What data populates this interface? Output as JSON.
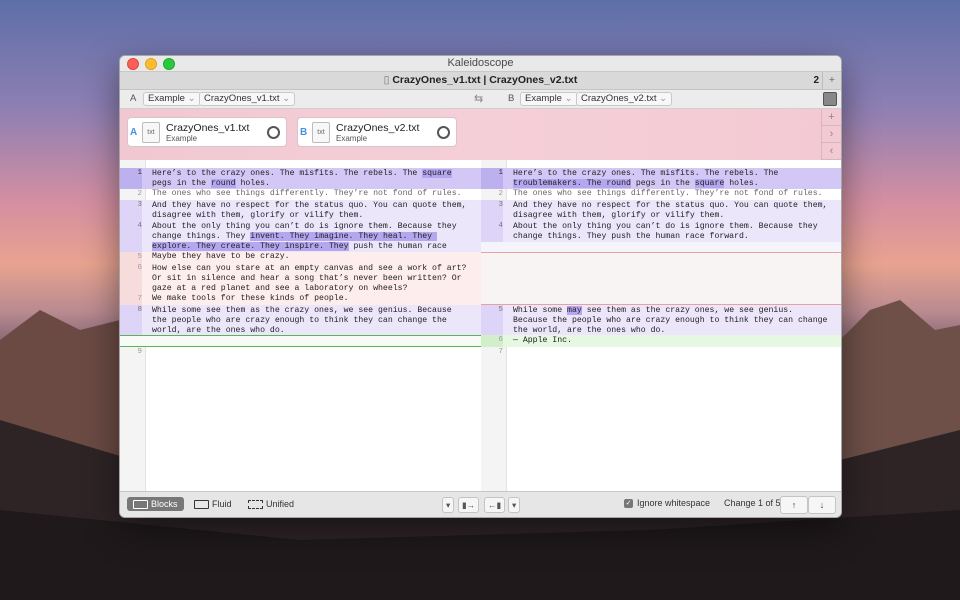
{
  "window": {
    "title": "Kaleidoscope"
  },
  "tab": {
    "title": "CrazyOnes_v1.txt | CrazyOnes_v2.txt",
    "count": "2",
    "add": "+"
  },
  "pathbar": {
    "a_label": "A",
    "a_folder": "Example",
    "a_file": "CrazyOnes_v1.txt",
    "b_label": "B",
    "b_folder": "Example",
    "b_file": "CrazyOnes_v2.txt",
    "swap": "⇆"
  },
  "files": {
    "a": {
      "letter": "A",
      "name": "CrazyOnes_v1.txt",
      "sub": "Example"
    },
    "b": {
      "letter": "B",
      "name": "CrazyOnes_v2.txt",
      "sub": "Example"
    },
    "side_buttons": [
      "+",
      "›",
      "‹"
    ]
  },
  "left_pane": {
    "lines": [
      {
        "n": "1",
        "pre": "Here’s to the crazy ones. The misfits. The rebels. The ",
        "h1": "square",
        "mid": " pegs in the ",
        "h2": "round",
        "post": " holes."
      },
      {
        "n": "2",
        "text": "The ones who see things differently. They’re not fond of rules."
      },
      {
        "n": "3",
        "text": "And they have no respect for the status quo. You can quote them, disagree with them, glorify or vilify them."
      },
      {
        "n": "4",
        "pre": "About the only thing you can’t do is ignore them. Because they change things. They ",
        "h1": "invent. They imagine. They heal. They explore. They create. They inspire. They",
        "post": " push the human race forward."
      },
      {
        "n": "5",
        "text": "Maybe they have to be crazy."
      },
      {
        "n": "6",
        "text": "How else can you stare at an empty canvas and see a work of art? Or sit in silence and hear a song that’s never been written? Or gaze at a red planet and see a laboratory on wheels?"
      },
      {
        "n": "7",
        "text": "We make tools for these kinds of people."
      },
      {
        "n": "8",
        "text": "While some see them as the crazy ones, we see genius. Because the people who are crazy enough to think they can change the world, are the ones who do."
      },
      {
        "n": "9",
        "text": ""
      }
    ]
  },
  "right_pane": {
    "lines": [
      {
        "n": "1",
        "pre": "Here’s to the crazy ones. The misfits. The rebels. The ",
        "h1": "troublemakers. The round",
        "mid": " pegs in the ",
        "h2": "square",
        "post": " holes."
      },
      {
        "n": "2",
        "text": "The ones who see things differently. They’re not fond of rules."
      },
      {
        "n": "3",
        "text": "And they have no respect for the status quo. You can quote them, disagree with them, glorify or vilify them."
      },
      {
        "n": "4",
        "text": "About the only thing you can’t do is ignore them. Because they change things. They push the human race forward."
      },
      {
        "n": "5",
        "pre": "While some ",
        "h1": "may",
        "post": " see them as the crazy ones, we see genius. Because the people who are crazy enough to think they can change the world, are the ones who do."
      },
      {
        "n": "6",
        "text": "— Apple Inc."
      },
      {
        "n": "7",
        "text": ""
      }
    ]
  },
  "status": {
    "modes": [
      "Blocks",
      "Fluid",
      "Unified"
    ],
    "active_mode": "Blocks",
    "ignore_whitespace": "Ignore whitespace",
    "ignore_checked": true,
    "change": "Change 1 of 5",
    "up": "↑",
    "down": "↓"
  }
}
